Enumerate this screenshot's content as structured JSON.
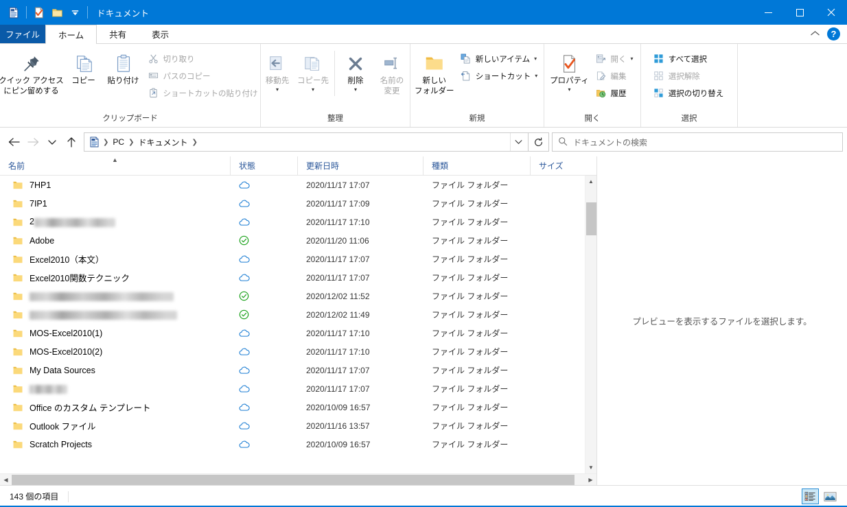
{
  "window": {
    "title": "ドキュメント",
    "quick_access": [
      {
        "name": "documents-icon",
        "label": "ドキュメント"
      },
      {
        "name": "properties-icon",
        "label": "プロパティ"
      },
      {
        "name": "new-folder-icon",
        "label": "新しいフォルダー"
      },
      {
        "name": "customize-qat-icon",
        "label": "クイック アクセス ツール バーのユーザー設定"
      }
    ],
    "controls": {
      "minimize": "─",
      "maximize": "□",
      "close": "✕"
    },
    "accent_color": "#0078d7"
  },
  "tabs": [
    {
      "label": "ファイル",
      "id": "file"
    },
    {
      "label": "ホーム",
      "id": "home"
    },
    {
      "label": "共有",
      "id": "share"
    },
    {
      "label": "表示",
      "id": "view"
    }
  ],
  "active_tab": "ホーム",
  "ribbon_right": {
    "collapse_label": "リボンを折りたたむ",
    "help_label": "?"
  },
  "ribbon": {
    "groups": [
      {
        "label": "クリップボード",
        "big_buttons": [
          {
            "label": "クイック アクセス\nにピン留めする",
            "line1": "クイック アクセス",
            "line2": "にピン留めする",
            "icon": "pin-icon",
            "disabled": false
          },
          {
            "label": "コピー",
            "line1": "コピー",
            "line2": "",
            "icon": "copy-icon",
            "disabled": false
          },
          {
            "label": "貼り付け",
            "line1": "貼り付け",
            "line2": "",
            "icon": "paste-icon",
            "disabled": false
          }
        ],
        "small_buttons": [
          {
            "label": "切り取り",
            "icon": "scissors-icon",
            "disabled": true
          },
          {
            "label": "パスのコピー",
            "icon": "copy-path-icon",
            "disabled": true
          },
          {
            "label": "ショートカットの貼り付け",
            "icon": "paste-shortcut-icon",
            "disabled": true
          }
        ]
      },
      {
        "label": "整理",
        "big_buttons": [
          {
            "label": "移動先",
            "line1": "移動先",
            "line2": "",
            "icon": "move-to-icon",
            "disabled": true,
            "caret": true
          },
          {
            "label": "コピー先",
            "line1": "コピー先",
            "line2": "",
            "icon": "copy-to-icon",
            "disabled": true,
            "caret": true
          },
          {
            "label": "削除",
            "line1": "削除",
            "line2": "",
            "icon": "delete-icon",
            "disabled": false,
            "caret": true
          },
          {
            "label": "名前の変更",
            "line1": "名前の",
            "line2": "変更",
            "icon": "rename-icon",
            "disabled": true
          }
        ],
        "small_buttons": []
      },
      {
        "label": "新規",
        "big_buttons": [
          {
            "label": "新しいフォルダー",
            "line1": "新しい",
            "line2": "フォルダー",
            "icon": "new-folder-icon",
            "disabled": false
          }
        ],
        "small_buttons": [
          {
            "label": "新しいアイテム",
            "icon": "new-item-icon",
            "disabled": false,
            "caret": true
          },
          {
            "label": "ショートカット",
            "icon": "shortcut-icon",
            "disabled": false,
            "caret": true
          }
        ]
      },
      {
        "label": "開く",
        "big_buttons": [
          {
            "label": "プロパティ",
            "line1": "プロパティ",
            "line2": "",
            "icon": "properties-icon",
            "disabled": false,
            "caret": true
          }
        ],
        "small_buttons": [
          {
            "label": "開く",
            "icon": "open-icon",
            "disabled": true,
            "caret": true
          },
          {
            "label": "編集",
            "icon": "edit-icon",
            "disabled": true
          },
          {
            "label": "履歴",
            "icon": "history-icon",
            "disabled": false
          }
        ]
      },
      {
        "label": "選択",
        "big_buttons": [],
        "small_buttons": [
          {
            "label": "すべて選択",
            "icon": "select-all-icon",
            "disabled": false
          },
          {
            "label": "選択解除",
            "icon": "select-none-icon",
            "disabled": true
          },
          {
            "label": "選択の切り替え",
            "icon": "invert-selection-icon",
            "disabled": false
          }
        ]
      }
    ]
  },
  "address_bar": {
    "back_label": "戻る",
    "forward_label": "進む",
    "recent_label": "最近表示した場所",
    "up_label": "上へ",
    "breadcrumbs": [
      "PC",
      "ドキュメント"
    ],
    "dropdown_label": "以前の場所",
    "refresh_label": "更新"
  },
  "search": {
    "placeholder": "ドキュメントの検索",
    "value": ""
  },
  "columns": [
    {
      "label": "名前",
      "sorted": true,
      "sort_dir": "asc"
    },
    {
      "label": "状態",
      "sorted": false
    },
    {
      "label": "更新日時",
      "sorted": false
    },
    {
      "label": "種類",
      "sorted": false
    },
    {
      "label": "サイズ",
      "sorted": false
    }
  ],
  "files": [
    {
      "name": "7HP1",
      "redacted": false,
      "status": "cloud-only-icon",
      "date": "2020/11/17 17:07",
      "type": "ファイル フォルダー",
      "size": ""
    },
    {
      "name": "7IP1",
      "redacted": false,
      "status": "cloud-only-icon",
      "date": "2020/11/17 17:09",
      "type": "ファイル フォルダー",
      "size": ""
    },
    {
      "name": "2",
      "redacted": true,
      "redact_width": 118,
      "prefix": "2",
      "status": "cloud-only-icon",
      "date": "2020/11/17 17:10",
      "type": "ファイル フォルダー",
      "size": ""
    },
    {
      "name": "Adobe",
      "redacted": false,
      "status": "available-offline-icon",
      "date": "2020/11/20 11:06",
      "type": "ファイル フォルダー",
      "size": ""
    },
    {
      "name": "Excel2010（本文）",
      "redacted": false,
      "status": "cloud-only-icon",
      "date": "2020/11/17 17:07",
      "type": "ファイル フォルダー",
      "size": ""
    },
    {
      "name": "Excel2010関数テクニック",
      "redacted": false,
      "status": "cloud-only-icon",
      "date": "2020/11/17 17:07",
      "type": "ファイル フォルダー",
      "size": ""
    },
    {
      "name": "",
      "redacted": true,
      "redact_width": 210,
      "prefix": "",
      "status": "available-offline-icon",
      "date": "2020/12/02 11:52",
      "type": "ファイル フォルダー",
      "size": ""
    },
    {
      "name": "",
      "redacted": true,
      "redact_width": 215,
      "prefix": "",
      "status": "available-offline-icon",
      "date": "2020/12/02 11:49",
      "type": "ファイル フォルダー",
      "size": ""
    },
    {
      "name": "MOS-Excel2010(1)",
      "redacted": false,
      "status": "cloud-only-icon",
      "date": "2020/11/17 17:10",
      "type": "ファイル フォルダー",
      "size": ""
    },
    {
      "name": "MOS-Excel2010(2)",
      "redacted": false,
      "status": "cloud-only-icon",
      "date": "2020/11/17 17:10",
      "type": "ファイル フォルダー",
      "size": ""
    },
    {
      "name": "My Data Sources",
      "redacted": false,
      "status": "cloud-only-icon",
      "date": "2020/11/17 17:07",
      "type": "ファイル フォルダー",
      "size": ""
    },
    {
      "name": "",
      "redacted": true,
      "redact_width": 55,
      "prefix": "",
      "status": "cloud-only-icon",
      "date": "2020/11/17 17:07",
      "type": "ファイル フォルダー",
      "size": ""
    },
    {
      "name": "Office のカスタム テンプレート",
      "redacted": false,
      "status": "cloud-only-icon",
      "date": "2020/10/09 16:57",
      "type": "ファイル フォルダー",
      "size": ""
    },
    {
      "name": "Outlook ファイル",
      "redacted": false,
      "status": "cloud-only-icon",
      "date": "2020/11/16 13:57",
      "type": "ファイル フォルダー",
      "size": ""
    },
    {
      "name": "Scratch Projects",
      "redacted": false,
      "status": "cloud-only-icon",
      "date": "2020/10/09 16:57",
      "type": "ファイル フォルダー",
      "size": ""
    }
  ],
  "preview_pane": {
    "message": "プレビューを表示するファイルを選択します。"
  },
  "status_bar": {
    "item_count": "143 個の項目",
    "views": [
      {
        "name": "details-view-button",
        "label": "詳細表示",
        "active": true
      },
      {
        "name": "large-icons-view-button",
        "label": "大アイコン表示",
        "active": false
      }
    ]
  }
}
